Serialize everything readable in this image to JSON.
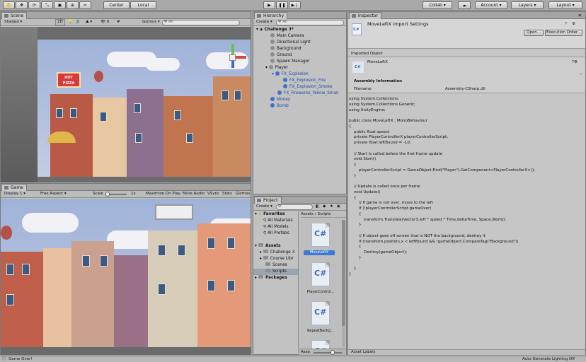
{
  "toolbar": {
    "pivot_label": "Center",
    "space_label": "Local",
    "collab_label": "Collab",
    "account_label": "Account",
    "layers_label": "Layers",
    "layout_label": "Layout"
  },
  "scene": {
    "tab_label": "Scene",
    "shading_mode": "Shaded",
    "mode_2d": "2D",
    "gizmos_label": "Gizmos",
    "search_placeholder": "All",
    "effects_count": "0",
    "art_text": "HOT PIZZA"
  },
  "game": {
    "tab_label": "Game",
    "display": "Display 1",
    "aspect": "Free Aspect",
    "scale_label": "Scale",
    "scale_value": "1x",
    "maximize": "Maximize On Play",
    "mute": "Mute Audio",
    "vsync": "VSync",
    "stats": "Stats",
    "gizmos": "Gizmos"
  },
  "hierarchy": {
    "tab_label": "Hierarchy",
    "create_label": "Create",
    "search_placeholder": "All",
    "scene_name": "Challenge 3*",
    "items": [
      {
        "label": "Main Camera"
      },
      {
        "label": "Directional Light"
      },
      {
        "label": "Background"
      },
      {
        "label": "Ground"
      },
      {
        "label": "Spawn Manager"
      },
      {
        "label": "Player"
      },
      {
        "label": "FX_Explosion"
      },
      {
        "label": "FX_Explosion_Fire"
      },
      {
        "label": "FX_Explosion_Smoke"
      },
      {
        "label": "FX_Fireworks_Yellow_Small"
      },
      {
        "label": "Money"
      },
      {
        "label": "Bomb"
      }
    ]
  },
  "project": {
    "tab_label": "Project",
    "create_label": "Create",
    "favorites_label": "Favorites",
    "favorites": [
      "All Materials",
      "All Models",
      "All Prefabs"
    ],
    "assets_label": "Assets",
    "asset_folders": [
      "Challenge 3",
      "Course Libr",
      "Scenes",
      "Scripts"
    ],
    "packages_label": "Packages",
    "breadcrumb_root": "Assets",
    "breadcrumb_sep": "›",
    "breadcrumb_leaf": "Scripts",
    "files": [
      {
        "name": "MoveLeftX"
      },
      {
        "name": "PlayerControl..."
      },
      {
        "name": "RepeatBackg..."
      },
      {
        "name": ""
      }
    ],
    "footer_label": "Asse"
  },
  "inspector": {
    "tab_label": "Inspector",
    "title": "MoveLeftX Import Settings",
    "open_button": "Open...",
    "exec_order_button": "Execution Order...",
    "imported_object_label": "Imported Object",
    "object_name": "MoveLeftX",
    "object_icon_text": "C#",
    "assembly_heading": "Assembly Information",
    "filename_label": "Filename",
    "filename_value": "Assembly-CSharp.dll",
    "code": "using System.Collections;\nusing System.Collections.Generic;\nusing UnityEngine;\n\npublic class MoveLeftX : MonoBehaviour\n{\n    public float speed;\n    private PlayerControllerX playerControllerScript;\n    private float leftBound = -10;\n\n    // Start is called before the first frame update\n    void Start()\n    {\n        playerControllerScript = GameObject.Find(\"Player\").GetComponent<PlayerControllerX>();\n    }\n\n    // Update is called once per frame\n    void Update()\n    {\n        // If game is not over, move to the left\n        if (!playerControllerScript.gameOver)\n        {\n            transform.Translate(Vector3.left * speed * Time.deltaTime, Space.World);\n        }\n\n        // If object goes off screen that is NOT the background, destroy it\n        if (transform.position.x < leftBound && !gameObject.CompareTag(\"Background\"))\n        {\n            Destroy(gameObject);\n        }\n\n    }\n}",
    "asset_labels": "Asset Labels"
  },
  "status": {
    "message": "Game Over!",
    "right_text": "Auto Generate Lighting Off"
  },
  "colors": {
    "accent": "#3b78d8",
    "panel": "#c2c2c2",
    "sky": "#a9b9dc"
  }
}
